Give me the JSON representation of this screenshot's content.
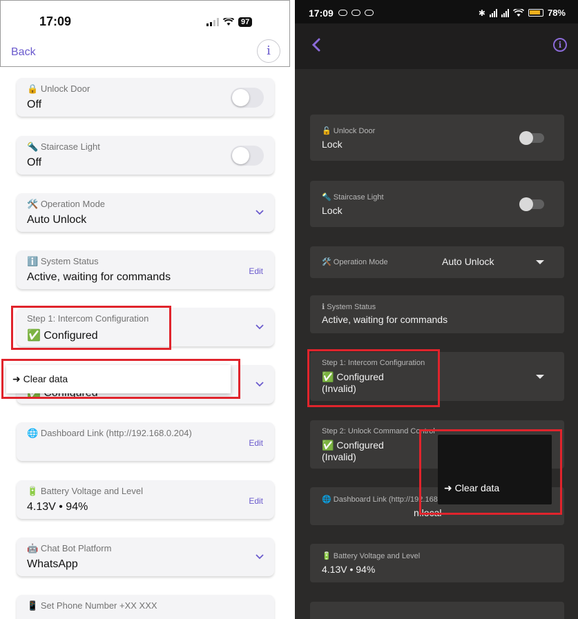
{
  "left": {
    "status": {
      "time": "17:09",
      "battery": "97"
    },
    "nav": {
      "back_label": "Back",
      "info_label": "i"
    },
    "cards": {
      "unlock_door": {
        "icon": "🔒",
        "title": "Unlock Door",
        "value": "Off",
        "control": "toggle",
        "toggle_on": false
      },
      "staircase_light": {
        "icon": "🔦",
        "title": "Staircase Light",
        "value": "Off",
        "control": "toggle",
        "toggle_on": false
      },
      "operation_mode": {
        "icon": "🛠️",
        "title": "Operation Mode",
        "value": "Auto Unlock",
        "control": "dropdown"
      },
      "system_status": {
        "icon": "ℹ️",
        "title": "System Status",
        "value": "Active, waiting for commands",
        "edit_label": "Edit"
      },
      "step1": {
        "title": "Step 1: Intercom Configuration",
        "value": "✅ Configured",
        "control": "dropdown"
      },
      "step2": {
        "value": "✅ Configured",
        "control": "dropdown"
      },
      "dashboard": {
        "icon": "🌐",
        "title": "Dashboard Link (http://192.168.0.204)",
        "edit_label": "Edit"
      },
      "battery": {
        "icon": "🔋",
        "title": "Battery Voltage and Level",
        "value": "4.13V • 94%",
        "edit_label": "Edit"
      },
      "chatbot": {
        "icon": "🤖",
        "title": "Chat Bot Platform",
        "value": "WhatsApp",
        "control": "dropdown"
      },
      "phone": {
        "icon": "📱",
        "title": "Set Phone Number +XX XXX"
      }
    },
    "context_menu": {
      "item": "➜ Clear data"
    }
  },
  "right": {
    "status": {
      "time": "17:09",
      "battery": "78%"
    },
    "nav": {
      "info_label": "i"
    },
    "cards": {
      "unlock_door": {
        "icon": "🔓",
        "title": "Unlock Door",
        "value": "Lock",
        "toggle_on": false
      },
      "staircase_light": {
        "icon": "🔦",
        "title": "Staircase Light",
        "value": "Lock",
        "toggle_on": false
      },
      "operation_mode": {
        "icon": "🛠️",
        "title": "Operation Mode",
        "value": "Auto Unlock"
      },
      "system_status": {
        "icon": "ℹ",
        "title": "System Status",
        "value": "Active, waiting for commands"
      },
      "step1": {
        "title": "Step 1: Intercom Configuration",
        "value": "✅ Configured",
        "value2": "(Invalid)"
      },
      "step2": {
        "title": "Step 2: Unlock Command Control",
        "value": "✅ Configured",
        "value2": "(Invalid)"
      },
      "dashboard": {
        "icon": "🌐",
        "title": "Dashboard Link (http://192.168.",
        "value": "n.local"
      },
      "battery": {
        "icon": "🔋",
        "title": "Battery Voltage and Level",
        "value": "4.13V • 94%"
      }
    },
    "context_menu": {
      "item": "➜ Clear data"
    }
  },
  "colors": {
    "accent_ios": "#6a5acd",
    "accent_android": "#8b6bd8",
    "highlight": "#e0242c"
  }
}
